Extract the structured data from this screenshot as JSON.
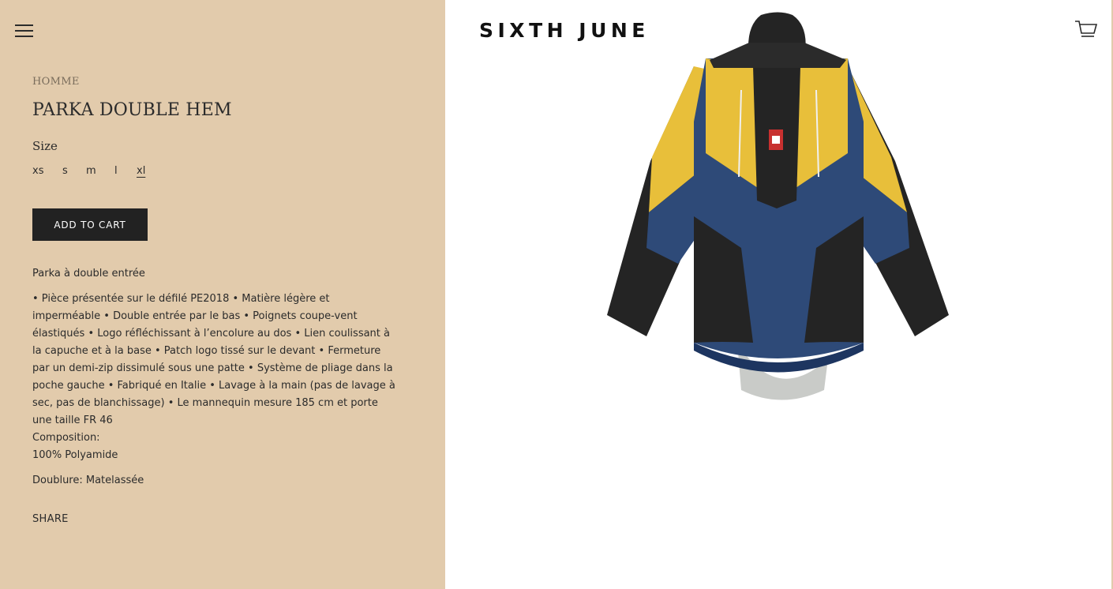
{
  "header": {
    "brand": "SIXTH JUNE",
    "menu_icon": "hamburger-menu-icon",
    "cart_icon": "shopping-cart-icon"
  },
  "product": {
    "category": "HOMME",
    "title": "PARKA DOUBLE HEM",
    "size_label": "Size",
    "sizes": [
      "xs",
      "s",
      "m",
      "l",
      "xl"
    ],
    "selected_size": "xl",
    "add_to_cart_label": "ADD TO CART",
    "description_intro": "Parka à double entrée",
    "description_body": "• Pièce présentée sur le défilé PE2018 • Matière légère et imperméable • Double entrée par le bas • Poignets coupe-vent élastiqués • Logo réfléchissant à l’encolure au dos • Lien coulissant à la capuche et à la base • Patch logo tissé sur le devant • Fermeture par un demi-zip dissimulé sous une patte • Système de pliage dans la poche gauche • Fabriqué en Italie • Lavage à la main (pas de lavage à sec, pas de blanchissage) • Le mannequin mesure 185 cm et porte une taille FR 46",
    "composition_label": "Composition:",
    "composition_value": "100% Polyamide",
    "lining": "Doublure: Matelassée",
    "share_label": "SHARE"
  },
  "colors": {
    "left_panel_bg": "#e2cbac",
    "button_bg": "#222222",
    "jacket_yellow": "#e8bf3a",
    "jacket_navy": "#2e4a78",
    "jacket_black": "#242424",
    "jacket_lining": "#c9cbc8"
  }
}
